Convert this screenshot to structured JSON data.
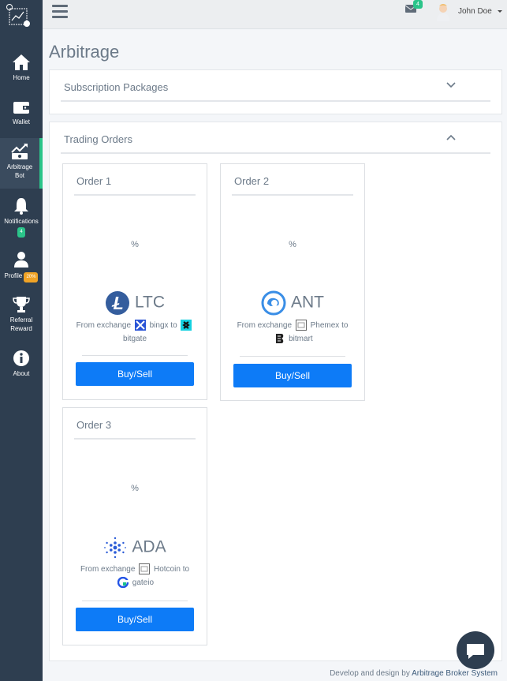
{
  "sidebar": {
    "items": [
      {
        "label": "Home",
        "icon": "home-icon"
      },
      {
        "label": "Wallet",
        "icon": "wallet-icon"
      },
      {
        "label": "Arbitrage",
        "label2": "Bot",
        "icon": "chart-icon"
      },
      {
        "label": "Notifications",
        "badge": "4",
        "icon": "bell-icon"
      },
      {
        "label": "Profile",
        "badge": "20%",
        "icon": "user-icon"
      },
      {
        "label": "Referral",
        "label2": "Reward",
        "icon": "trophy-icon"
      },
      {
        "label": "About",
        "icon": "info-icon"
      }
    ]
  },
  "topbar": {
    "mail_badge": "4",
    "user_name": "John Doe"
  },
  "page": {
    "title": "Arbitrage"
  },
  "subscription": {
    "title": "Subscription Packages"
  },
  "trading": {
    "title": "Trading Orders",
    "from_prefix": "From exchange",
    "to_word": "to",
    "orders": [
      {
        "title": "Order 1",
        "percent": "%",
        "coin": "LTC",
        "from": "bingx",
        "to": "bitgate",
        "button": "Buy/Sell"
      },
      {
        "title": "Order 2",
        "percent": "%",
        "coin": "ANT",
        "from": "Phemex",
        "to": "bitmart",
        "button": "Buy/Sell"
      },
      {
        "title": "Order 3",
        "percent": "%",
        "coin": "ADA",
        "from": "Hotcoin",
        "to": "gateio",
        "button": "Buy/Sell"
      }
    ]
  },
  "footer": {
    "prefix": "Develop and design by",
    "link": "Arbitrage Broker System"
  },
  "colors": {
    "sidebar": "#2e3e50",
    "accent": "#2bc48a",
    "button": "#0d7bf7"
  }
}
